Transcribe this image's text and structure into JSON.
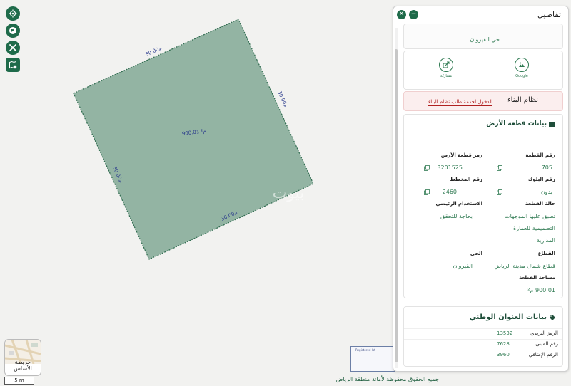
{
  "map": {
    "parcel_area": "900.01 م²",
    "edge_lengths": [
      "30.00م",
      "30.00م",
      "30.00م",
      "30.00م"
    ],
    "watermark": "بيوت",
    "basemap_label": "خريطة الأساس",
    "scale_label": "5 m",
    "copyright": "جميع الحقوق محفوظة لأمانة منطقة الرياض",
    "minimap_title": "Registered lot",
    "colors": {
      "parcel_fill": "#93b4a3",
      "parcel_stroke": "#2f6b4f",
      "accent": "#1f6b4a"
    },
    "tools": [
      "locate-icon",
      "globe-icon",
      "tools-icon",
      "map-book-icon"
    ]
  },
  "panel": {
    "title": "تفاصيل",
    "district_line": "حي القيروان",
    "actions": {
      "google": "Google",
      "share": "مشاركة"
    },
    "building_system": {
      "label": "نظام البناء",
      "link": "الدخول لخدمة طلب نظام البناء"
    },
    "land": {
      "heading": "بيانات قطعة الأرض",
      "plot_no": {
        "label": "رقم القطعة",
        "value": "705"
      },
      "plot_code": {
        "label": "رمز قطعة الأرض",
        "value": "3201525"
      },
      "block_no": {
        "label": "رقم البلوك",
        "value": "بدون"
      },
      "plan_no": {
        "label": "رقم المخطط",
        "value": "2460"
      },
      "plot_status": {
        "label": "حالة القطعة",
        "value1": "تطبق عليها الموجهات",
        "value2": "التصميمية للعمارة",
        "value3": "المدارية"
      },
      "main_use": {
        "label": "الاستخدام الرئيسي",
        "value": "بحاجة للتحقق"
      },
      "sector": {
        "label": "القطاع",
        "value": "قطاع شمال مدينة الرياض"
      },
      "district": {
        "label": "الحي",
        "value": "القيروان"
      },
      "area": {
        "label": "مساحة القطعة",
        "value": "900.01 م²"
      }
    },
    "address": {
      "heading": "بيانات العنوان الوطني",
      "postal": {
        "label": "الرمز البريدي",
        "value": "13532"
      },
      "building": {
        "label": "رقم المبنى",
        "value": "7628"
      },
      "additional": {
        "label": "الرقم الإضافي",
        "value": "3960"
      }
    }
  }
}
